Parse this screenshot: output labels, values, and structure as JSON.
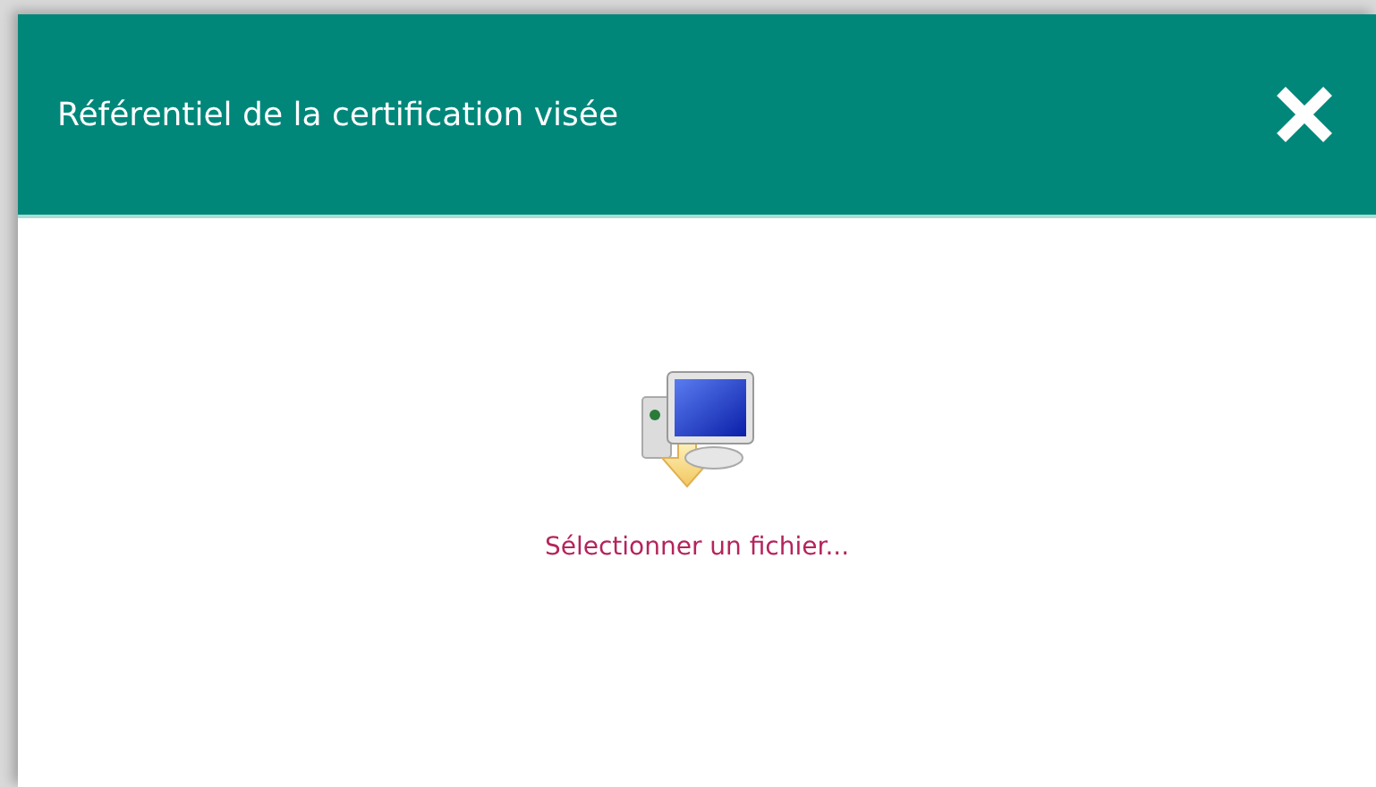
{
  "dialog": {
    "title": "Référentiel de la certification visée",
    "file_picker": {
      "label": "Sélectionner un fichier..."
    }
  }
}
